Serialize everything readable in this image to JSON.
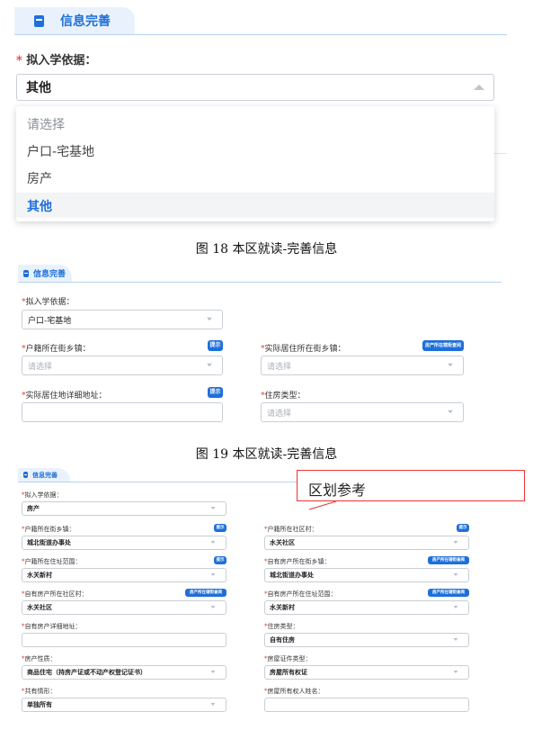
{
  "fig18": {
    "tab_title": "信息完善",
    "basis_label": "拟入学依据：",
    "basis_value": "其他",
    "options": [
      "请选择",
      "户口-宅基地",
      "房产",
      "其他"
    ],
    "caption": "图 18 本区就读-完善信息"
  },
  "fig19": {
    "tab_title": "信息完善",
    "basis_label": "拟入学依据：",
    "basis_value": "户口-宅基地",
    "hukou_street_label": "户籍所在街乡镇：",
    "hukou_street_placeholder": "请选择",
    "hint_label": "提示",
    "actual_street_label": "实际居住所在街乡镇：",
    "actual_street_placeholder": "请选择",
    "query_label": "房产所在辖街查阅",
    "actual_address_label": "实际居住地详细地址：",
    "hint_label2": "提示",
    "housing_type_label": "住房类型：",
    "housing_type_placeholder": "请选择",
    "caption": "图 19 本区就读-完善信息"
  },
  "fig20": {
    "tab_title": "信息完善",
    "callout": "区划参考",
    "hint_label": "提示",
    "query_label": "房产所在辖街查阅",
    "left": [
      {
        "label": "拟入学依据：",
        "value": "房产",
        "btn": ""
      },
      {
        "label": "户籍所在街乡镇：",
        "value": "城北街道办事处",
        "btn": "提示"
      },
      {
        "label": "户籍所在住址范围：",
        "value": "水关新村",
        "btn": "提示"
      },
      {
        "label": "自有房产所在社区村：",
        "value": "水关社区",
        "btn": "房产所在辖街查阅"
      },
      {
        "label": "自有房产详细地址：",
        "value": "",
        "btn": ""
      },
      {
        "label": "房产性质：",
        "value": "商品住宅（持房产证或不动产权登记证书）",
        "btn": ""
      },
      {
        "label": "共有情形：",
        "value": "单独所有",
        "btn": ""
      }
    ],
    "right": [
      {
        "label": "户籍所在社区村：",
        "value": "水关社区",
        "btn": "提示"
      },
      {
        "label": "自有房产所在街乡镇：",
        "value": "城北街道办事处",
        "btn": "房产所在辖街查阅"
      },
      {
        "label": "自有房产所在住址范围：",
        "value": "水关新村",
        "btn": "房产所在辖街查阅"
      },
      {
        "label": "住房类型：",
        "value": "自有住房",
        "btn": ""
      },
      {
        "label": "房屋证件类型：",
        "value": "房屋所有权证",
        "btn": ""
      },
      {
        "label": "房屋所有权人姓名：",
        "value": "",
        "btn": ""
      }
    ]
  }
}
